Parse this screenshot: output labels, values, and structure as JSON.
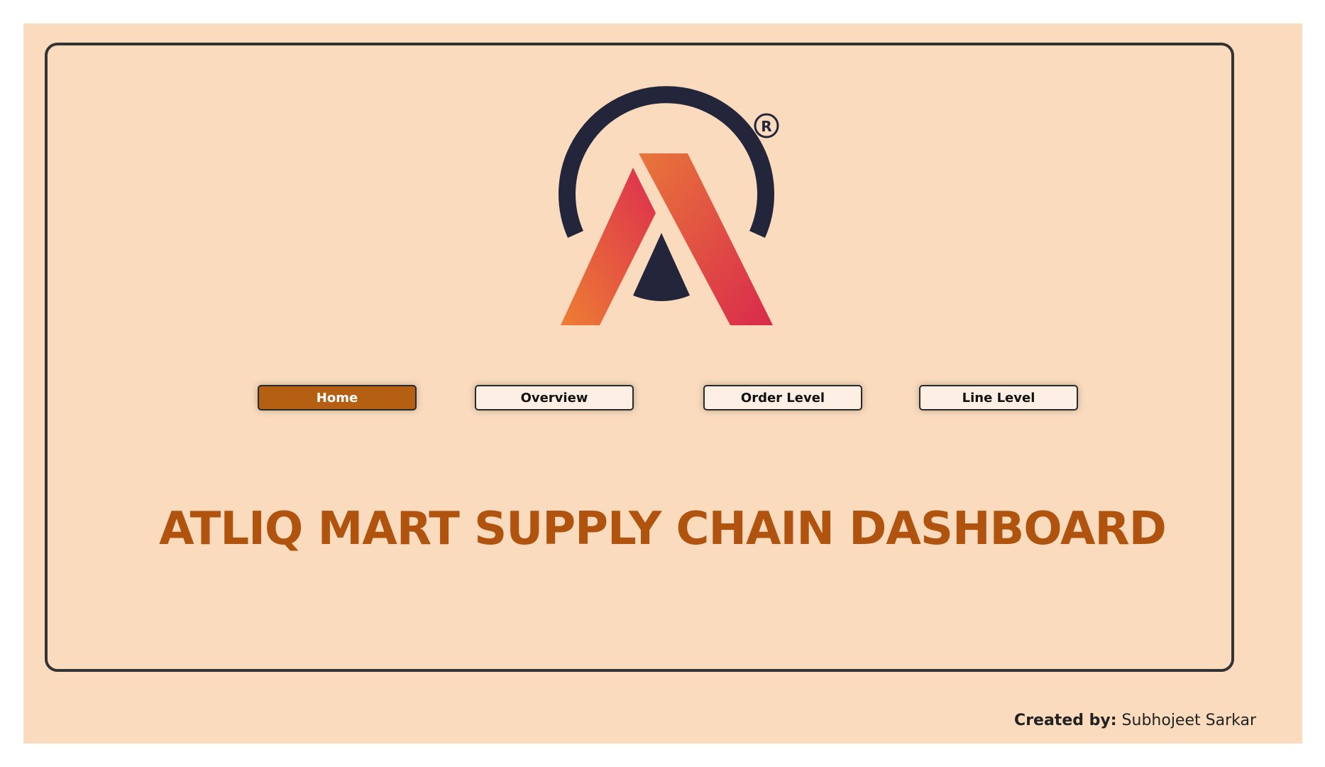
{
  "nav": {
    "home_label": "Home",
    "overview_label": "Overview",
    "order_level_label": "Order Level",
    "line_level_label": "Line Level"
  },
  "title": "ATLIQ MART SUPPLY CHAIN DASHBOARD",
  "credit": {
    "label": "Created by:",
    "name": "Subhojeet Sarkar"
  },
  "logo": {
    "icon": "atliq-logo",
    "registered_mark": "®"
  },
  "colors": {
    "background": "#fadbbe",
    "accent": "#b45f12",
    "title": "#b0530f",
    "button_bg": "#fdefe3",
    "logo_dark": "#23263a",
    "logo_orange": "#e8763a",
    "logo_red": "#db2f4c"
  }
}
